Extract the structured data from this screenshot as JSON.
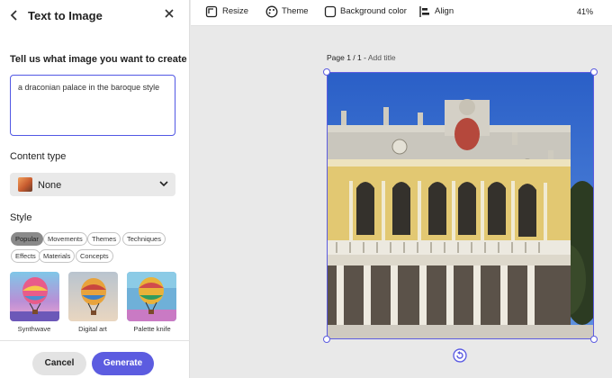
{
  "panel": {
    "title": "Text to Image",
    "prompt_label": "Tell us what image you want to create",
    "prompt_value": "a draconian palace in the baroque style",
    "content_type_label": "Content type",
    "content_type_value": "None",
    "style_label": "Style",
    "style_chips": [
      "Popular",
      "Movements",
      "Themes",
      "Techniques",
      "Effects",
      "Materials",
      "Concepts"
    ],
    "active_chip": "Popular",
    "thumbnails": [
      "Synthwave",
      "Digital art",
      "Palette knife"
    ],
    "cancel_label": "Cancel",
    "generate_label": "Generate",
    "accent_color": "#5c5ce0"
  },
  "toolbar": {
    "resize_label": "Resize",
    "theme_label": "Theme",
    "background_color_label": "Background color",
    "align_label": "Align",
    "zoom": "41%"
  },
  "canvas": {
    "page_label": "Page 1 / 1 -",
    "add_title": "Add title",
    "image_icon": "baroque-palace-image",
    "rotate_icon": "rotate-icon"
  }
}
